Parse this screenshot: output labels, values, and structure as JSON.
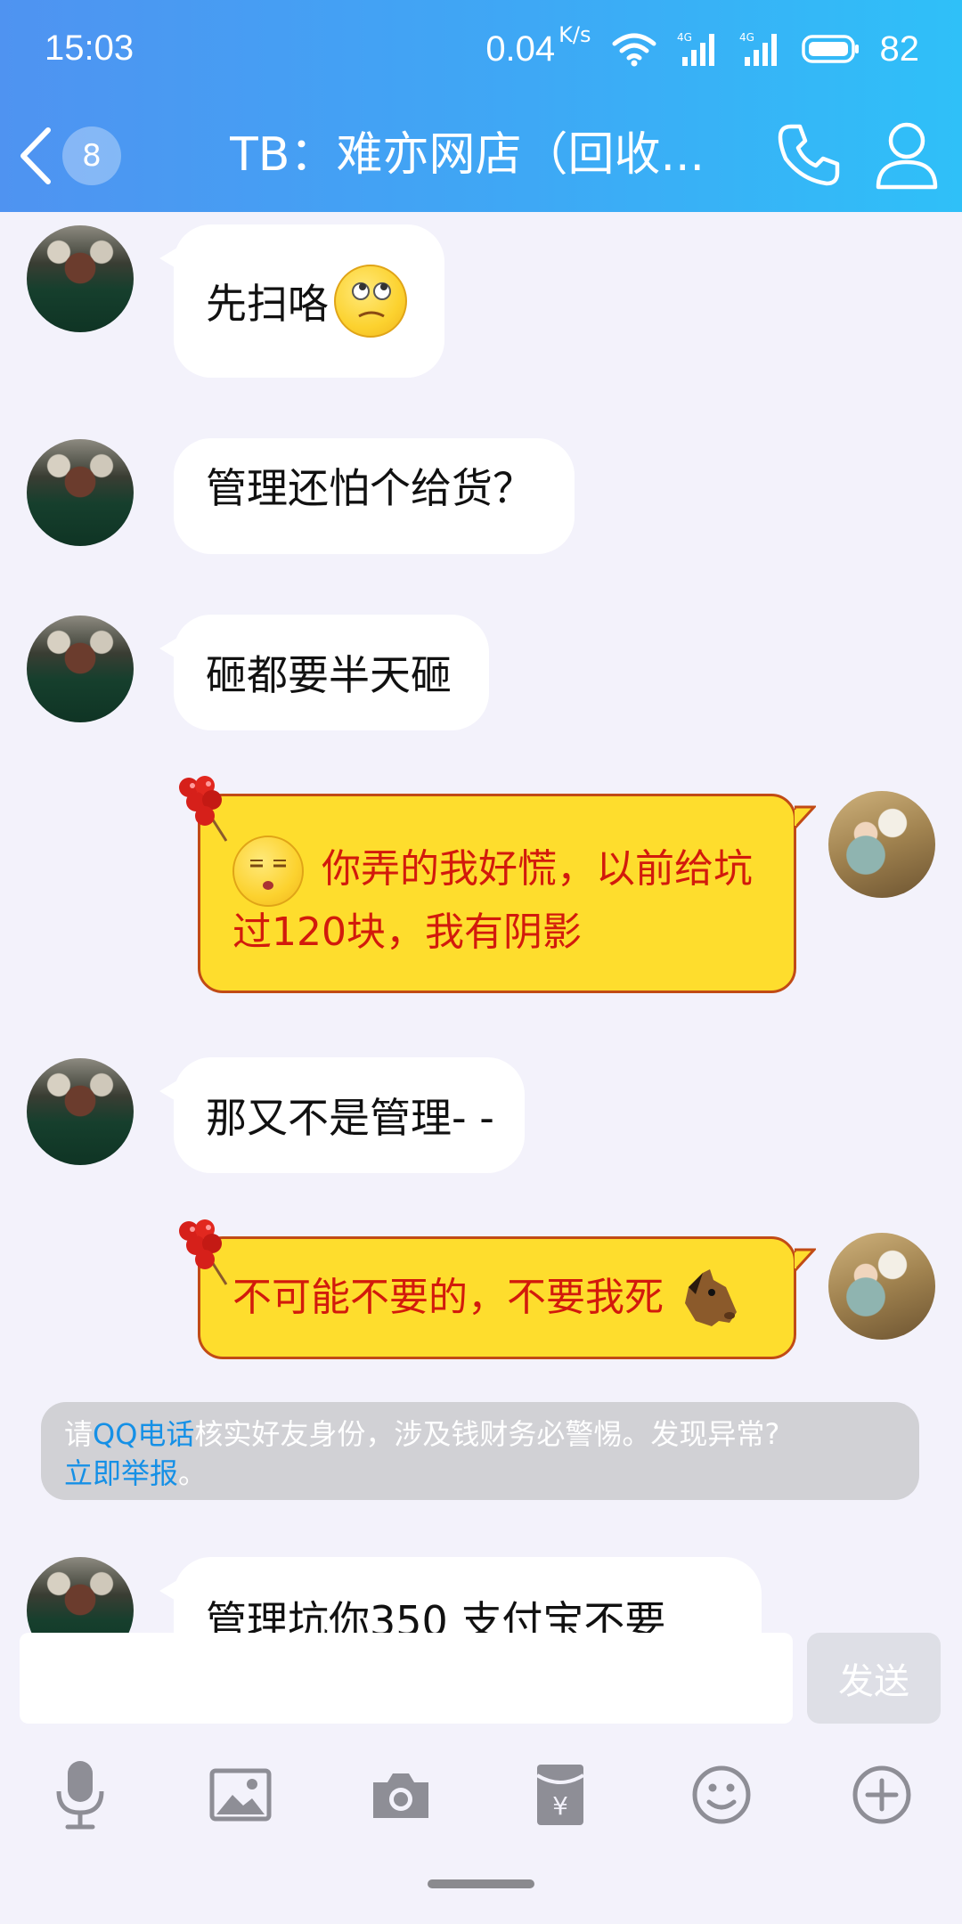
{
  "status_bar": {
    "time": "15:03",
    "net_speed": "0.04",
    "net_unit": "K/s",
    "network_1": "4G",
    "network_2": "4G",
    "battery": "82"
  },
  "header": {
    "unread_count": "8",
    "title": "TB：难亦网店（回收..."
  },
  "messages": [
    {
      "from": "contact",
      "text": "先扫咯",
      "emoji": "rolling-eyes-face"
    },
    {
      "from": "contact",
      "text": "管理还怕个给货？"
    },
    {
      "from": "contact",
      "text": "砸都要半天砸"
    },
    {
      "from": "me",
      "text": "你弄的我好慌，以前给坑过120块，我有阴影",
      "emoji": "sleepy-face"
    },
    {
      "from": "contact",
      "text": "那又不是管理- -"
    },
    {
      "from": "me",
      "text": "不可能不要的，不要我死",
      "emoji": "horse-face"
    },
    {
      "from": "contact",
      "text": "管理坑你350 支付宝不要"
    }
  ],
  "warning": {
    "prefix": "请",
    "link1": "QQ电话",
    "middle": "核实好友身份，涉及钱财务必警惕。发现异常?",
    "link2": "立即举报",
    "suffix": "。"
  },
  "input": {
    "value": "",
    "send_label": "发送"
  },
  "toolbar": [
    "microphone-icon",
    "image-icon",
    "camera-icon",
    "red-packet-icon",
    "emoji-icon",
    "plus-icon"
  ],
  "colors": {
    "header_start": "#4f93f1",
    "header_end": "#2fc0f8",
    "bubble_out": "#fedd2d",
    "bubble_out_text": "#d21a0c",
    "bubble_out_border": "#c14b15",
    "link": "#1590e6"
  }
}
